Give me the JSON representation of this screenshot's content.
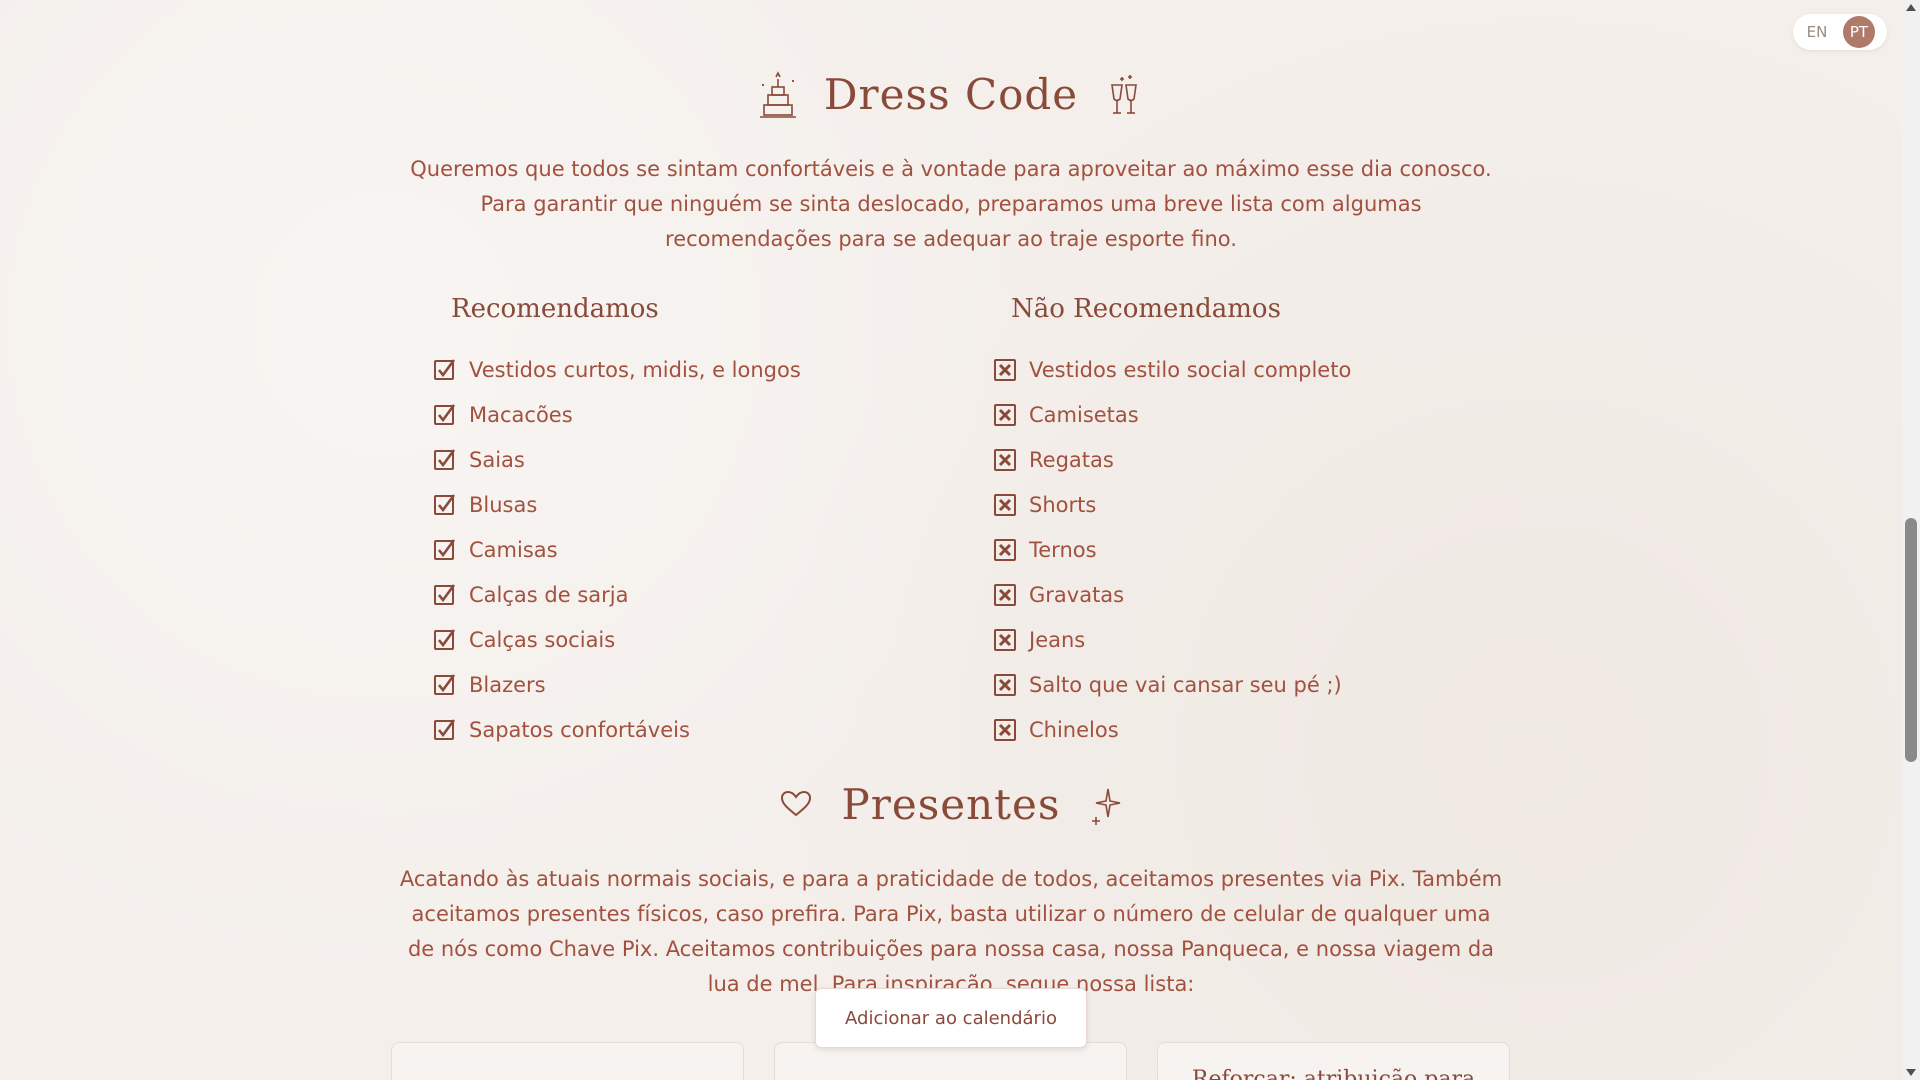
{
  "language_toggle": {
    "options": [
      {
        "label": "EN",
        "active": false
      },
      {
        "label": "PT",
        "active": true
      }
    ]
  },
  "dress_code": {
    "title": "Dress Code",
    "description": "Queremos que todos se sintam confortáveis e à vontade para aproveitar ao máximo esse dia conosco. Para garantir que ninguém se sinta deslocado, preparamos uma breve lista com algumas recomendações para se adequar ao traje esporte fino.",
    "recommended": {
      "title": "Recomendamos",
      "items": [
        "Vestidos curtos, midis, e longos",
        "Macacões",
        "Saias",
        "Blusas",
        "Camisas",
        "Calças de sarja",
        "Calças sociais",
        "Blazers",
        "Sapatos confortáveis"
      ]
    },
    "not_recommended": {
      "title": "Não Recomendamos",
      "items": [
        "Vestidos estilo social completo",
        "Camisetas",
        "Regatas",
        "Shorts",
        "Ternos",
        "Gravatas",
        "Jeans",
        "Salto que vai cansar seu pé ;)",
        "Chinelos"
      ]
    }
  },
  "gifts": {
    "title": "Presentes",
    "description": "Acatando às atuais normais sociais, e para a praticidade de todos, aceitamos presentes via Pix. Também aceitamos presentes físicos, caso prefira. Para Pix, basta utilizar o número de celular de qualquer uma de nós como Chave Pix. Aceitamos contribuições para nossa casa, nossa Panqueca, e nossa viagem da lua de mel. Para inspiração, segue nossa lista:",
    "cards": [
      {
        "text": ""
      },
      {
        "text": ""
      },
      {
        "text": "Reforçar: atribuição para"
      }
    ]
  },
  "calendar_button": {
    "label": "Adicionar ao calendário"
  },
  "colors": {
    "text": "#a3513f",
    "heading": "#8a4a3a",
    "background": "#f4efeb",
    "accent": "#b07a6a"
  },
  "icons": {
    "title_left_dress": "cake-icon",
    "title_right_dress": "champagne-glasses-icon",
    "title_left_gifts": "heart-icon",
    "title_right_gifts": "sparkle-icon",
    "check": "checkbox-checked-icon",
    "cross": "checkbox-x-icon"
  }
}
